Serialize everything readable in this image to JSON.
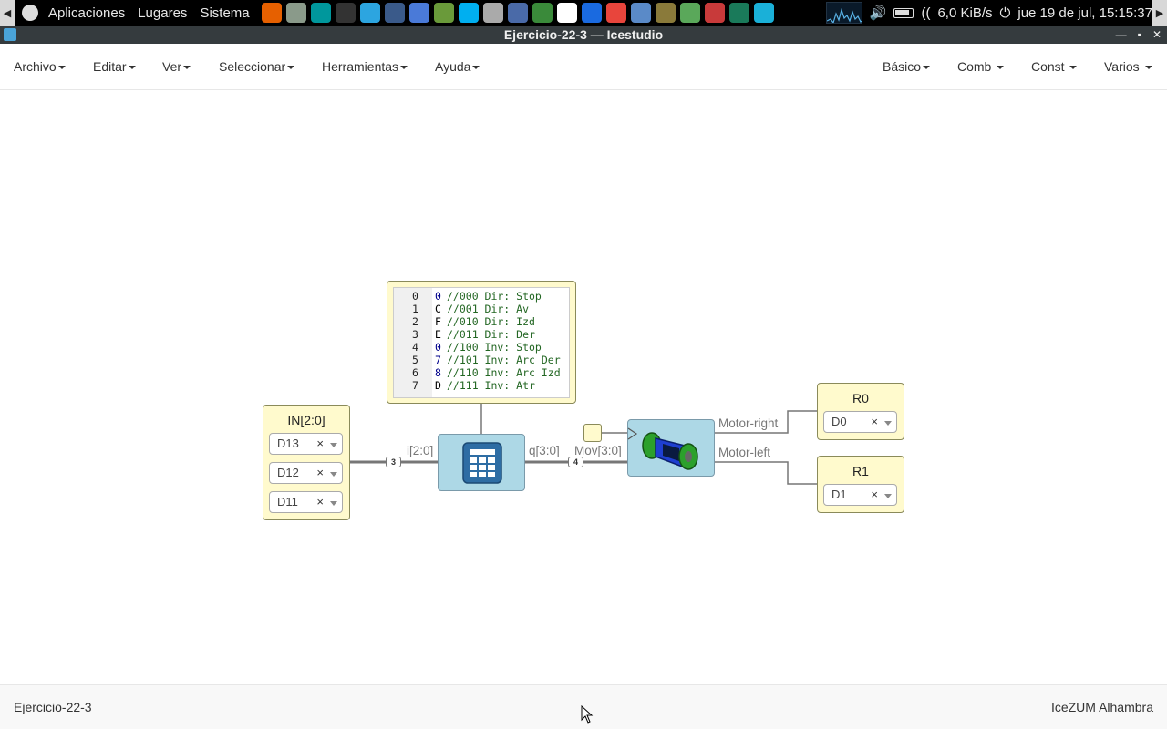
{
  "system_panel": {
    "menus": [
      "Aplicaciones",
      "Lugares",
      "Sistema"
    ],
    "launcher_icons": [
      "firefox-icon",
      "files-icon",
      "arduino-icon",
      "terminal-icon",
      "telegram-icon",
      "monitor-icon",
      "chromium-icon",
      "editor-icon",
      "skype-icon",
      "calculator-icon",
      "virtualbox-icon",
      "spreadsheet-icon",
      "player-icon",
      "teamviewer-icon",
      "chrome-icon",
      "network-icon",
      "image-icon",
      "gear-green-icon",
      "settings-icon",
      "keepass-icon",
      "app-c-icon"
    ],
    "net_speed": "6,0 KiB/s",
    "datetime": "jue 19 de jul, 15:15:37"
  },
  "window": {
    "title": "Ejercicio-22-3 — Icestudio"
  },
  "menubar": {
    "left": [
      "Archivo",
      "Editar",
      "Ver",
      "Seleccionar",
      "Herramientas",
      "Ayuda"
    ],
    "right": [
      "Básico",
      "Comb",
      "Const",
      "Varios"
    ]
  },
  "circuit": {
    "input_block": {
      "title": "IN[2:0]",
      "pins": [
        "D13",
        "D12",
        "D11"
      ]
    },
    "table_code": [
      {
        "idx": "0",
        "val": "0",
        "comment": "//000 Dir: Stop"
      },
      {
        "idx": "1",
        "val": "C",
        "comment": "//001 Dir: Av"
      },
      {
        "idx": "2",
        "val": "F",
        "comment": "//010 Dir: Izd"
      },
      {
        "idx": "3",
        "val": "E",
        "comment": "//011 Dir: Der"
      },
      {
        "idx": "4",
        "val": "0",
        "comment": "//100 Inv: Stop"
      },
      {
        "idx": "5",
        "val": "7",
        "comment": "//101 Inv: Arc Der"
      },
      {
        "idx": "6",
        "val": "8",
        "comment": "//110 Inv: Arc Izd"
      },
      {
        "idx": "7",
        "val": "D",
        "comment": "//111 Inv: Atr"
      }
    ],
    "wires": {
      "in_label": "i[2:0]",
      "in_width": "3",
      "out_label": "q[3:0]",
      "mov_label": "Mov[3:0]",
      "mov_width": "4",
      "motor_right": "Motor-right",
      "motor_left": "Motor-left"
    },
    "output_r0": {
      "title": "R0",
      "pin": "D0"
    },
    "output_r1": {
      "title": "R1",
      "pin": "D1"
    }
  },
  "statusbar": {
    "project": "Ejercicio-22-3",
    "board": "IceZUM Alhambra"
  },
  "colors": {
    "block_yellow": "#fffacd",
    "block_blue": "#add8e6",
    "wire": "#777777"
  }
}
